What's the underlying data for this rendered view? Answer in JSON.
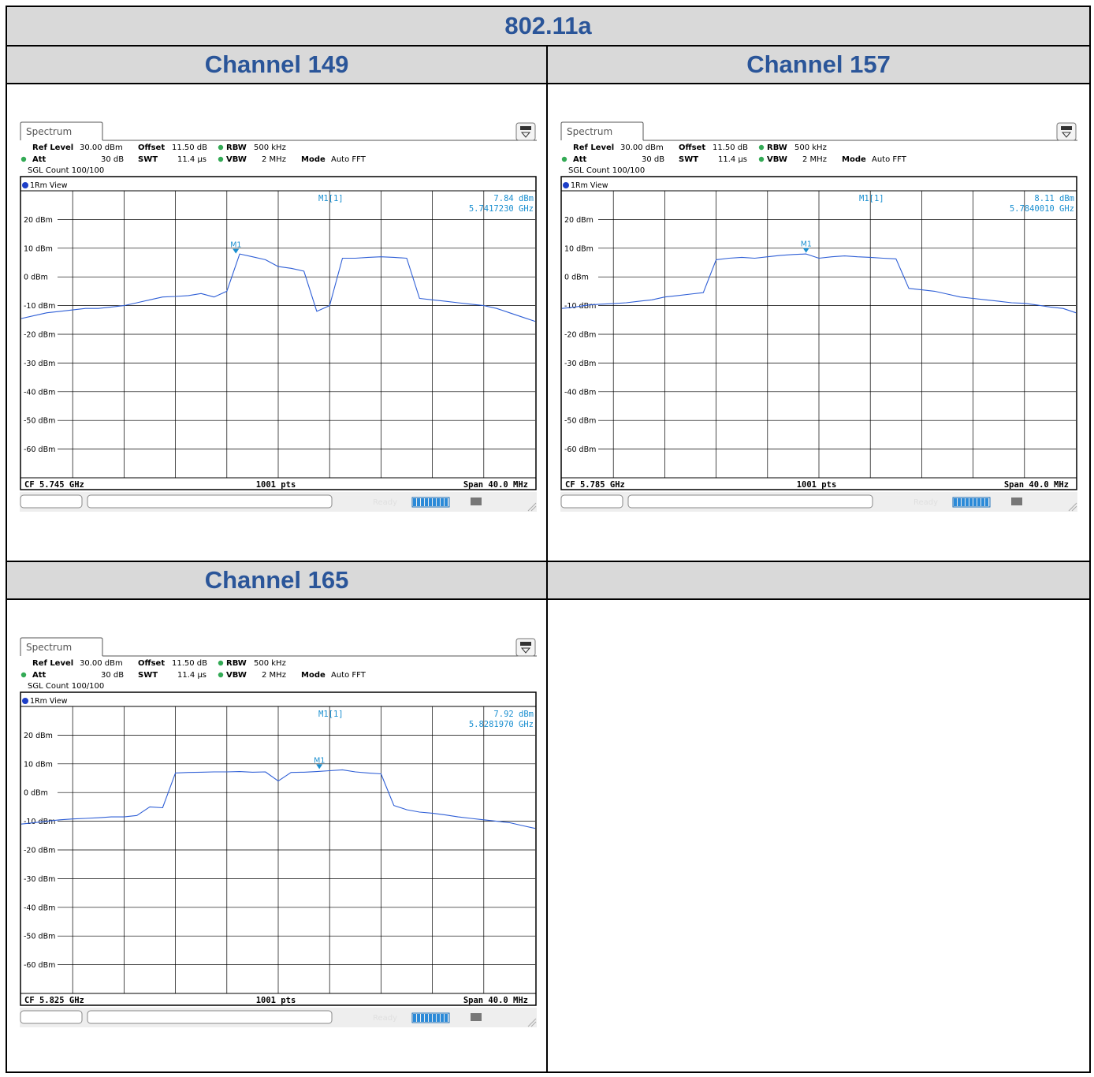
{
  "table": {
    "title": "802.11a",
    "empty_header": ""
  },
  "colors": {
    "header_bg": "#d9d9d9",
    "header_text": "#2a5599",
    "trace": "#2f5fd6",
    "marker": "#1a8fd0"
  },
  "chart_data": [
    {
      "type": "line",
      "channel_label": "Channel 149",
      "tab_label": "Spectrum",
      "settings": {
        "ref_level_label": "Ref Level",
        "ref_level_value": "30.00 dBm",
        "offset_label": "Offset",
        "offset_value": "11.50 dB",
        "rbw_label": "RBW",
        "rbw_value": "500 kHz",
        "att_label": "Att",
        "att_value": "30 dB",
        "swt_label": "SWT",
        "swt_value": "11.4 µs",
        "vbw_label": "VBW",
        "vbw_value": "2 MHz",
        "mode_label": "Mode",
        "mode_value": "Auto FFT",
        "count": "SGL Count 100/100"
      },
      "view_label": "1Rm View",
      "marker": {
        "label": "M1",
        "readout_name": "M1[1]",
        "level": "7.84 dBm",
        "freq": "5.7417230 GHz",
        "x_mhz": -3.3,
        "y_dbm": 7.84
      },
      "footer": {
        "left": "CF 5.745 GHz",
        "center": "1001 pts",
        "right": "Span 40.0 MHz"
      },
      "status_text": "Ready",
      "ylabels": [
        "20 dBm",
        "10 dBm",
        "0 dBm",
        "-10 dBm",
        "-20 dBm",
        "-30 dBm",
        "-40 dBm",
        "-50 dBm",
        "-60 dBm"
      ],
      "xlim_mhz": [
        -20,
        20
      ],
      "ylim_dbm": [
        -70,
        30
      ],
      "grid": true,
      "trace": {
        "x": [
          -20,
          -19,
          -18,
          -17,
          -16,
          -15,
          -14,
          -13,
          -12,
          -11,
          -10,
          -9,
          -8,
          -7,
          -6,
          -5,
          -4,
          -3,
          -2,
          -1,
          0,
          1,
          2,
          3,
          4,
          5,
          6,
          7,
          8,
          9,
          10,
          11,
          12,
          13,
          14,
          15,
          16,
          17,
          18,
          19,
          20
        ],
        "y": [
          -14.5,
          -13.5,
          -12.5,
          -12,
          -11.5,
          -11,
          -11,
          -10.5,
          -10,
          -9,
          -8,
          -7,
          -6.8,
          -6.5,
          -5.8,
          -7,
          -5,
          8,
          7,
          6,
          3.6,
          3,
          2,
          -12,
          -10,
          6.5,
          6.5,
          6.8,
          7,
          6.8,
          6.5,
          -7.5,
          -8,
          -8.5,
          -9,
          -9.5,
          -10,
          -11,
          -12.5,
          -14,
          -15.5
        ]
      }
    },
    {
      "type": "line",
      "channel_label": "Channel 157",
      "tab_label": "Spectrum",
      "settings": {
        "ref_level_label": "Ref Level",
        "ref_level_value": "30.00 dBm",
        "offset_label": "Offset",
        "offset_value": "11.50 dB",
        "rbw_label": "RBW",
        "rbw_value": "500 kHz",
        "att_label": "Att",
        "att_value": "30 dB",
        "swt_label": "SWT",
        "swt_value": "11.4 µs",
        "vbw_label": "VBW",
        "vbw_value": "2 MHz",
        "mode_label": "Mode",
        "mode_value": "Auto FFT",
        "count": "SGL Count 100/100"
      },
      "view_label": "1Rm View",
      "marker": {
        "label": "M1",
        "readout_name": "M1[1]",
        "level": "8.11 dBm",
        "freq": "5.7840010 GHz",
        "x_mhz": -1.0,
        "y_dbm": 8.11
      },
      "footer": {
        "left": "CF 5.785 GHz",
        "center": "1001 pts",
        "right": "Span 40.0 MHz"
      },
      "status_text": "Ready",
      "ylabels": [
        "20 dBm",
        "10 dBm",
        "0 dBm",
        "-10 dBm",
        "-20 dBm",
        "-30 dBm",
        "-40 dBm",
        "-50 dBm",
        "-60 dBm"
      ],
      "xlim_mhz": [
        -20,
        20
      ],
      "ylim_dbm": [
        -70,
        30
      ],
      "grid": true,
      "trace": {
        "x": [
          -20,
          -19,
          -18,
          -17,
          -16,
          -15,
          -14,
          -13,
          -12,
          -11,
          -10,
          -9,
          -8,
          -7,
          -6,
          -5,
          -4,
          -3,
          -2,
          -1,
          0,
          1,
          2,
          3,
          4,
          5,
          6,
          7,
          8,
          9,
          10,
          11,
          12,
          13,
          14,
          15,
          16,
          17,
          18,
          19,
          20
        ],
        "y": [
          -11,
          -10.5,
          -9.8,
          -9.5,
          -9.3,
          -9,
          -8.5,
          -8,
          -7,
          -6.5,
          -6,
          -5.5,
          6,
          6.5,
          6.8,
          6.5,
          7,
          7.5,
          7.8,
          8,
          6.5,
          7,
          7.3,
          7,
          6.8,
          6.5,
          6.3,
          -4,
          -4.5,
          -5,
          -6,
          -7,
          -7.5,
          -8,
          -8.5,
          -9,
          -9.2,
          -9.8,
          -10.5,
          -11,
          -12.5
        ]
      }
    },
    {
      "type": "line",
      "channel_label": "Channel 165",
      "tab_label": "Spectrum",
      "settings": {
        "ref_level_label": "Ref Level",
        "ref_level_value": "30.00 dBm",
        "offset_label": "Offset",
        "offset_value": "11.50 dB",
        "rbw_label": "RBW",
        "rbw_value": "500 kHz",
        "att_label": "Att",
        "att_value": "30 dB",
        "swt_label": "SWT",
        "swt_value": "11.4 µs",
        "vbw_label": "VBW",
        "vbw_value": "2 MHz",
        "mode_label": "Mode",
        "mode_value": "Auto FFT",
        "count": "SGL Count 100/100"
      },
      "view_label": "1Rm View",
      "marker": {
        "label": "M1",
        "readout_name": "M1[1]",
        "level": "7.92 dBm",
        "freq": "5.8281970 GHz",
        "x_mhz": 3.2,
        "y_dbm": 7.92
      },
      "footer": {
        "left": "CF 5.825 GHz",
        "center": "1001 pts",
        "right": "Span 40.0 MHz"
      },
      "status_text": "Ready",
      "ylabels": [
        "20 dBm",
        "10 dBm",
        "0 dBm",
        "-10 dBm",
        "-20 dBm",
        "-30 dBm",
        "-40 dBm",
        "-50 dBm",
        "-60 dBm"
      ],
      "xlim_mhz": [
        -20,
        20
      ],
      "ylim_dbm": [
        -70,
        30
      ],
      "grid": true,
      "trace": {
        "x": [
          -20,
          -19,
          -18,
          -17,
          -16,
          -15,
          -14,
          -13,
          -12,
          -11,
          -10,
          -9,
          -8,
          -7,
          -6,
          -5,
          -4,
          -3,
          -2,
          -1,
          0,
          1,
          2,
          3,
          4,
          5,
          6,
          7,
          8,
          9,
          10,
          11,
          12,
          13,
          14,
          15,
          16,
          17,
          18,
          19,
          20
        ],
        "y": [
          -11,
          -10.5,
          -10,
          -9.5,
          -9.2,
          -9,
          -8.8,
          -8.5,
          -8.5,
          -8,
          -5,
          -5.3,
          6.8,
          7,
          7.1,
          7.2,
          7.2,
          7.3,
          7.1,
          7.2,
          4,
          7,
          7.1,
          7.3,
          7.6,
          7.9,
          7.2,
          6.8,
          6.5,
          -4.5,
          -6,
          -6.8,
          -7.2,
          -7.8,
          -8.5,
          -9,
          -9.5,
          -10,
          -10.5,
          -11.5,
          -12.5
        ]
      }
    }
  ]
}
